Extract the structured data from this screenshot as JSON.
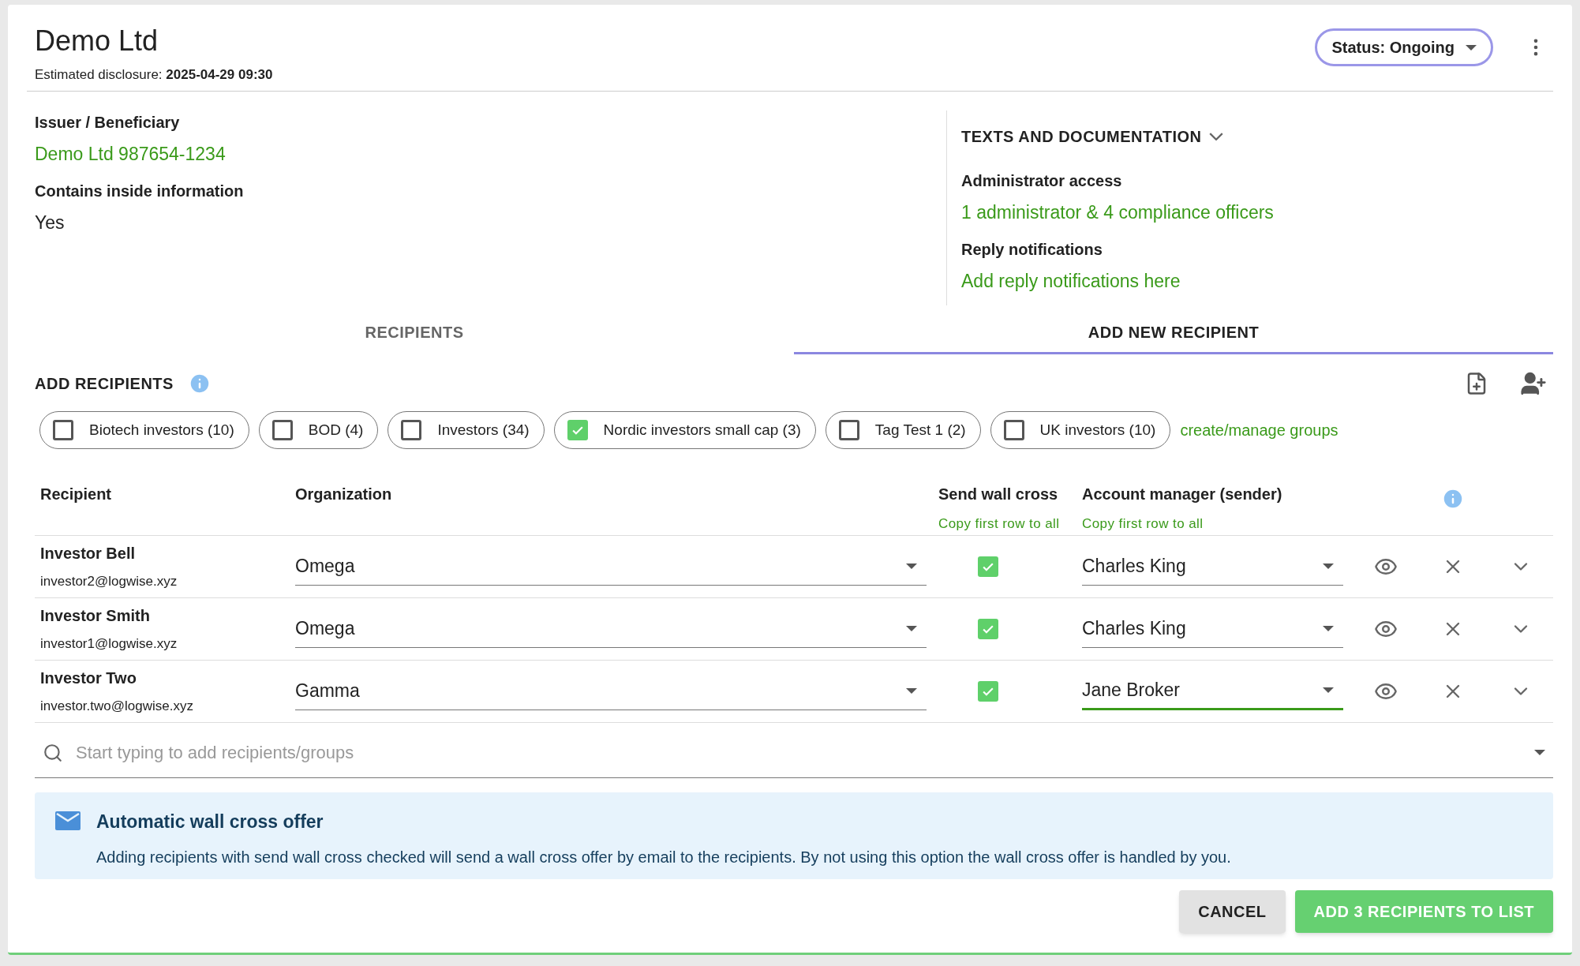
{
  "header": {
    "title": "Demo Ltd",
    "disclosure_label": "Estimated disclosure:",
    "disclosure_value": "2025-04-29 09:30",
    "status": "Status: Ongoing"
  },
  "details": [
    {
      "label": "Issuer / Beneficiary",
      "value": "Demo Ltd 987654-1234",
      "kind": "link"
    },
    {
      "label": "Contains inside information",
      "value": "Yes",
      "kind": "text"
    }
  ],
  "documentation": {
    "heading": "TEXTS AND DOCUMENTATION",
    "expanded": false,
    "items": [
      {
        "label": "Administrator access",
        "value": "1 administrator & 4 compliance officers"
      },
      {
        "label": "Reply notifications",
        "value": "Add reply notifications here"
      }
    ]
  },
  "tabs": [
    {
      "label": "RECIPIENTS",
      "selected": false
    },
    {
      "label": "ADD NEW RECIPIENT",
      "selected": true
    }
  ],
  "section_title": "ADD RECIPIENTS",
  "groups": [
    {
      "label": "Biotech investors (10)",
      "checked": false
    },
    {
      "label": "BOD (4)",
      "checked": false
    },
    {
      "label": "Investors (34)",
      "checked": false
    },
    {
      "label": "Nordic investors small cap (3)",
      "checked": true
    },
    {
      "label": "Tag Test 1 (2)",
      "checked": false
    },
    {
      "label": "UK investors (10)",
      "checked": false
    }
  ],
  "manage_groups_link": "create/manage groups",
  "table": {
    "columns": [
      {
        "label": "Recipient"
      },
      {
        "label": "Organization"
      },
      {
        "label": "Send wall cross",
        "link": "Copy first row to all"
      },
      {
        "label": "Account manager (sender)",
        "link": "Copy first row to all"
      }
    ],
    "rows": [
      {
        "name": "Investor Bell",
        "email": "investor2@logwise.xyz",
        "organization": "Omega",
        "send_wall_cross": true,
        "account_manager": "Charles King",
        "focused": false
      },
      {
        "name": "Investor Smith",
        "email": "investor1@logwise.xyz",
        "organization": "Omega",
        "send_wall_cross": true,
        "account_manager": "Charles King",
        "focused": false
      },
      {
        "name": "Investor Two",
        "email": "investor.two@logwise.xyz",
        "organization": "Gamma",
        "send_wall_cross": true,
        "account_manager": "Jane Broker",
        "focused": true
      }
    ]
  },
  "search": {
    "placeholder": "Start typing to add recipients/groups"
  },
  "notice": {
    "title": "Automatic wall cross offer",
    "text": "Adding recipients with send wall cross checked will send a wall cross offer by email to the recipients. By not using this option the wall cross offer is handled by you."
  },
  "buttons": [
    {
      "label": "CANCEL",
      "kind": "secondary"
    },
    {
      "label": "ADD 3 RECIPIENTS TO LIST",
      "kind": "primary"
    }
  ]
}
